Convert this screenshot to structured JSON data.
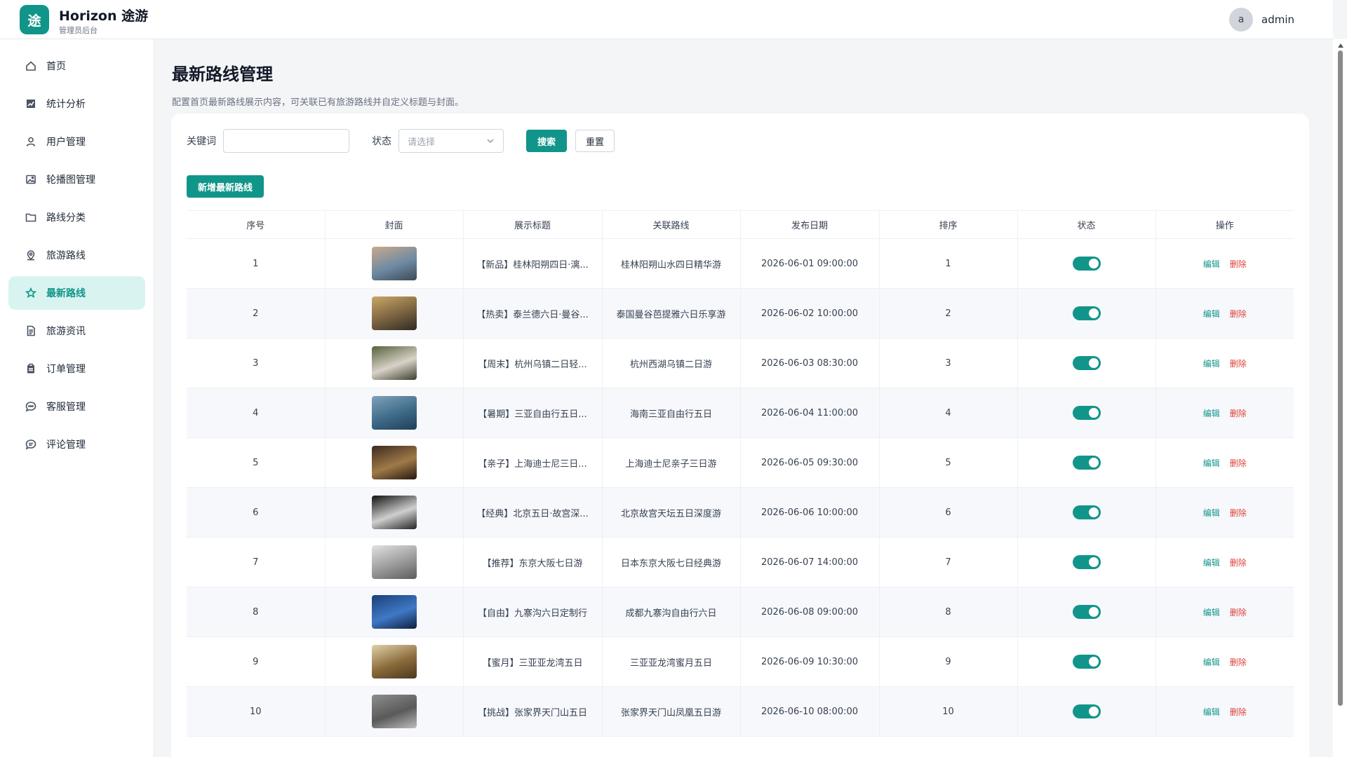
{
  "header": {
    "logo_char": "途",
    "app_name": "Horizon 途游",
    "app_sub": "管理员后台",
    "avatar_char": "a",
    "username": "admin"
  },
  "sidebar": {
    "items": [
      {
        "label": "首页",
        "icon": "home-icon"
      },
      {
        "label": "统计分析",
        "icon": "chart-icon"
      },
      {
        "label": "用户管理",
        "icon": "user-icon"
      },
      {
        "label": "轮播图管理",
        "icon": "image-icon"
      },
      {
        "label": "路线分类",
        "icon": "folder-icon"
      },
      {
        "label": "旅游路线",
        "icon": "location-icon"
      },
      {
        "label": "最新路线",
        "icon": "star-icon",
        "active": true
      },
      {
        "label": "旅游资讯",
        "icon": "document-icon"
      },
      {
        "label": "订单管理",
        "icon": "clipboard-icon"
      },
      {
        "label": "客服管理",
        "icon": "chat-icon"
      },
      {
        "label": "评论管理",
        "icon": "comment-icon"
      }
    ]
  },
  "page": {
    "title": "最新路线管理",
    "description": "配置首页最新路线展示内容，可关联已有旅游路线并自定义标题与封面。"
  },
  "filters": {
    "keyword_label": "关键词",
    "keyword_value": "",
    "status_label": "状态",
    "status_placeholder": "请选择",
    "search_label": "搜索",
    "reset_label": "重置"
  },
  "add_button_label": "新增最新路线",
  "table": {
    "columns": [
      "序号",
      "封面",
      "展示标题",
      "关联路线",
      "发布日期",
      "排序",
      "状态",
      "操作"
    ],
    "edit_label": "编辑",
    "delete_label": "删除",
    "rows": [
      {
        "no": "1",
        "title": "【新品】桂林阳朔四日·漓...",
        "route": "桂林阳朔山水四日精华游",
        "date": "2026-06-01 09:00:00",
        "sort": "1",
        "enabled": true,
        "cover": [
          "#c9a98a",
          "#6d8aa3",
          "#3c4a55"
        ]
      },
      {
        "no": "2",
        "title": "【热卖】泰兰德六日·曼谷...",
        "route": "泰国曼谷芭提雅六日乐享游",
        "date": "2026-06-02 10:00:00",
        "sort": "2",
        "enabled": true,
        "cover": [
          "#caa766",
          "#7a6240",
          "#2e2a22"
        ]
      },
      {
        "no": "3",
        "title": "【周末】杭州乌镇二日轻...",
        "route": "杭州西湖乌镇二日游",
        "date": "2026-06-03 08:30:00",
        "sort": "3",
        "enabled": true,
        "cover": [
          "#55623a",
          "#d8d2c8",
          "#3b3f2a"
        ]
      },
      {
        "no": "4",
        "title": "【暑期】三亚自由行五日...",
        "route": "海南三亚自由行五日",
        "date": "2026-06-04 11:00:00",
        "sort": "4",
        "enabled": true,
        "cover": [
          "#7fa2bb",
          "#3d6a88",
          "#1f3f57"
        ]
      },
      {
        "no": "5",
        "title": "【亲子】上海迪士尼三日...",
        "route": "上海迪士尼亲子三日游",
        "date": "2026-06-05 09:30:00",
        "sort": "5",
        "enabled": true,
        "cover": [
          "#3b2a1f",
          "#a07a48",
          "#24180f"
        ]
      },
      {
        "no": "6",
        "title": "【经典】北京五日·故宫深...",
        "route": "北京故宫天坛五日深度游",
        "date": "2026-06-06 10:00:00",
        "sort": "6",
        "enabled": true,
        "cover": [
          "#111111",
          "#cfcfcf",
          "#222222"
        ]
      },
      {
        "no": "7",
        "title": "【推荐】东京大阪七日游",
        "route": "日本东京大阪七日经典游",
        "date": "2026-06-07 14:00:00",
        "sort": "7",
        "enabled": true,
        "cover": [
          "#e2e2e2",
          "#9a9a9a",
          "#5c5c5c"
        ]
      },
      {
        "no": "8",
        "title": "【自由】九寨沟六日定制行",
        "route": "成都九寨沟自由行六日",
        "date": "2026-06-08 09:00:00",
        "sort": "8",
        "enabled": true,
        "cover": [
          "#1b3f7a",
          "#3f79c4",
          "#0e1f3f"
        ]
      },
      {
        "no": "9",
        "title": "【蜜月】三亚亚龙湾五日",
        "route": "三亚亚龙湾蜜月五日",
        "date": "2026-06-09 10:30:00",
        "sort": "9",
        "enabled": true,
        "cover": [
          "#e0d2a8",
          "#8a6a3a",
          "#4a3820"
        ]
      },
      {
        "no": "10",
        "title": "【挑战】张家界天门山五日",
        "route": "张家界天门山凤凰五日游",
        "date": "2026-06-10 08:00:00",
        "sort": "10",
        "enabled": true,
        "cover": [
          "#8d8d8d",
          "#5a5a5a",
          "#bdbdbd"
        ]
      }
    ]
  },
  "colors": {
    "accent": "#11958a",
    "danger": "#e0413a",
    "active_nav_bg": "#d9f4f0"
  }
}
